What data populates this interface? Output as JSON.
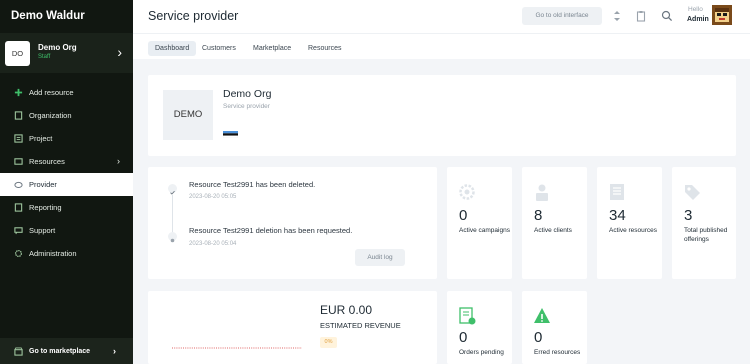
{
  "sidebar": {
    "brand": "Demo Waldur",
    "org": {
      "initials": "DO",
      "name": "Demo Org",
      "role": "Staff"
    },
    "items": [
      {
        "label": "Add resource",
        "icon": "plus-icon"
      },
      {
        "label": "Organization",
        "icon": "building-icon"
      },
      {
        "label": "Project",
        "icon": "folder-icon"
      },
      {
        "label": "Resources",
        "icon": "layers-icon"
      },
      {
        "label": "Provider",
        "icon": "cloud-icon"
      },
      {
        "label": "Reporting",
        "icon": "report-icon"
      },
      {
        "label": "Support",
        "icon": "support-icon"
      },
      {
        "label": "Administration",
        "icon": "gear-icon"
      }
    ],
    "marketplace_label": "Go to marketplace"
  },
  "header": {
    "title": "Service provider",
    "old_interface": "Go to old interface",
    "hello": "Hello",
    "user": "Admin"
  },
  "tabs": [
    "Dashboard",
    "Customers",
    "Marketplace",
    "Resources"
  ],
  "provider": {
    "logo_text": "DEMO",
    "name": "Demo Org",
    "subtitle": "Service provider"
  },
  "events": [
    {
      "text": "Resource Test2991 has been deleted.",
      "time": "2023-08-20 05:05"
    },
    {
      "text": "Resource Test2991 deletion has been requested.",
      "time": "2023-08-20 05:04"
    }
  ],
  "audit_log": "Audit log",
  "stats": [
    {
      "value": "0",
      "label": "Active campaigns",
      "icon": "campaign-icon"
    },
    {
      "value": "8",
      "label": "Active clients",
      "icon": "user-icon"
    },
    {
      "value": "34",
      "label": "Active resources",
      "icon": "resource-icon"
    },
    {
      "value": "3",
      "label": "Total published offerings",
      "icon": "tag-icon"
    }
  ],
  "revenue": {
    "amount": "EUR 0.00",
    "label": "ESTIMATED REVENUE",
    "change": "0%"
  },
  "orders": [
    {
      "value": "0",
      "label": "Orders pending",
      "icon": "orders-icon"
    },
    {
      "value": "0",
      "label": "Erred resources",
      "icon": "warning-icon"
    }
  ],
  "colors": {
    "sidebar_bg": "#111711",
    "accent": "#3fbf6a",
    "background": "#f3f5f8"
  }
}
